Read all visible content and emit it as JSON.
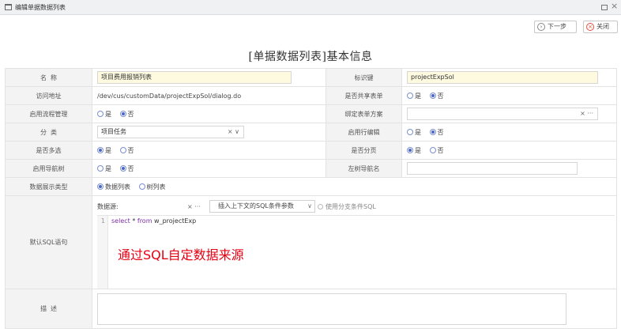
{
  "window": {
    "title": "编辑单据数据列表"
  },
  "toolbar": {
    "next_label": "下一步",
    "close_label": "关闭"
  },
  "page_title": "[单据数据列表]基本信息",
  "fields": {
    "name": {
      "label": "名  称",
      "value": "项目费用报销列表"
    },
    "identifier": {
      "label": "标识键",
      "value": "projectExpSol"
    },
    "url": {
      "label": "访问地址",
      "value": "/dev/cus/customData/projectExpSol/dialog.do"
    },
    "shared": {
      "label": "是否共享表单",
      "opt_yes": "是",
      "opt_no": "否"
    },
    "workflow": {
      "label": "启用流程管理",
      "opt_yes": "是",
      "opt_no": "否"
    },
    "bind_form": {
      "label": "绑定表单方案",
      "suffix": "× ···"
    },
    "category": {
      "label": "分  类",
      "value": "项目任务",
      "suffix": "× ∨"
    },
    "row_edit": {
      "label": "启用行编辑",
      "opt_yes": "是",
      "opt_no": "否"
    },
    "multi_select": {
      "label": "是否多选",
      "opt_yes": "是",
      "opt_no": "否"
    },
    "paging": {
      "label": "是否分页",
      "opt_yes": "是",
      "opt_no": "否"
    },
    "nav_tree": {
      "label": "启用导航树",
      "opt_yes": "是",
      "opt_no": "否"
    },
    "left_tree_name": {
      "label": "左树导航名"
    },
    "display_type": {
      "label": "数据展示类型",
      "opt_list": "数据列表",
      "opt_tree": "树列表"
    },
    "sql": {
      "label": "默认SQL语句",
      "datasource_label": "数据源:",
      "datasource_ctrl": "× ···",
      "insert_label": "插入上下文的SQL条件参数",
      "insert_chevron": "∨",
      "branch_label": "使用分支条件SQL",
      "line_no": "1",
      "code_kw1": "select",
      "code_star": " * ",
      "code_kw2": "from",
      "code_rest": " w_projectExp"
    },
    "description": {
      "label": "描  述"
    }
  },
  "overlay_note": "通过SQL自定数据来源",
  "colors": {
    "accent_blue": "#4a66c8",
    "highlight_red": "#e60012",
    "input_yellow": "#fdfae0",
    "label_bg": "#f3f3f3"
  }
}
